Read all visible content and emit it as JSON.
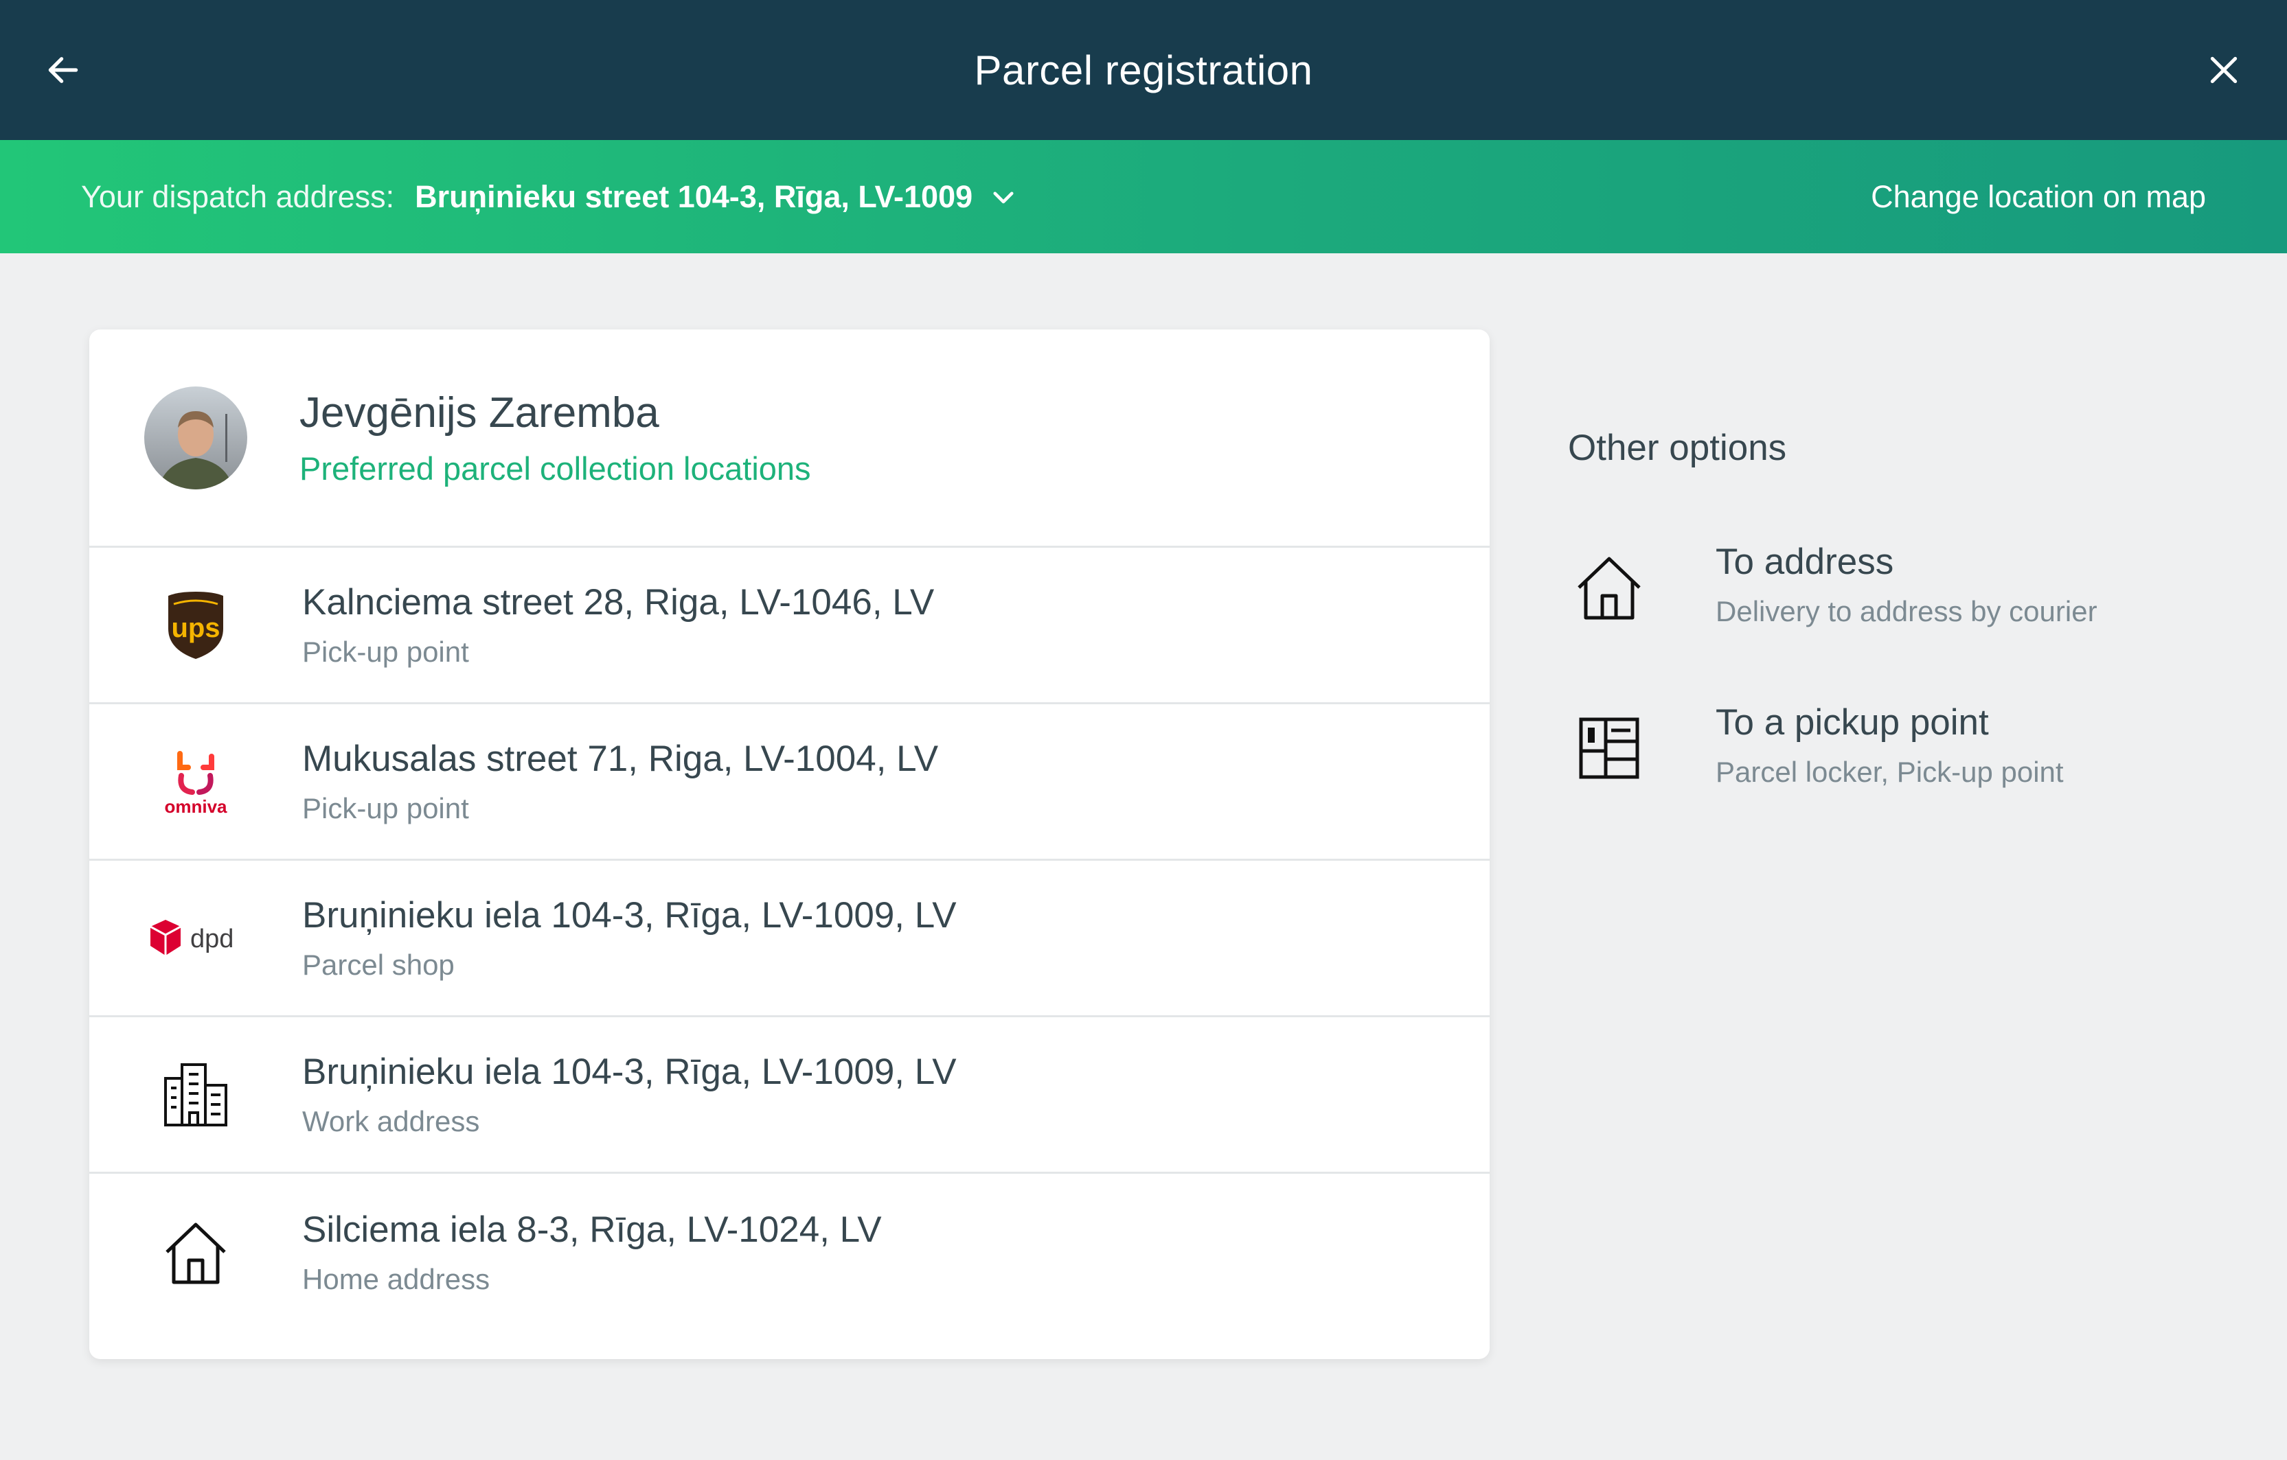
{
  "header": {
    "title": "Parcel registration",
    "back_icon": "arrow-left-icon",
    "close_icon": "close-icon",
    "bg_color": "#183c4d"
  },
  "dispatch": {
    "label": "Your dispatch address:",
    "address": "Bruņinieku street 104-3, Rīga, LV-1009",
    "change_location": "Change location on map",
    "accent_color": "#22c678"
  },
  "profile": {
    "name": "Jevgēnijs Zaremba",
    "subtitle": "Preferred parcel collection locations"
  },
  "locations": [
    {
      "icon": "ups-logo",
      "title": "Kalnciema street 28, Riga, LV-1046, LV",
      "subtitle": "Pick-up point"
    },
    {
      "icon": "omniva-logo",
      "logo_text": "omniva",
      "title": "Mukusalas street 71, Riga, LV-1004, LV",
      "subtitle": "Pick-up point"
    },
    {
      "icon": "dpd-logo",
      "logo_text": "dpd",
      "title": "Bruņinieku iela 104-3, Rīga, LV-1009, LV",
      "subtitle": "Parcel shop"
    },
    {
      "icon": "building-icon",
      "title": "Bruņinieku iela 104-3, Rīga, LV-1009, LV",
      "subtitle": "Work address"
    },
    {
      "icon": "home-icon",
      "title": "Silciema iela 8-3, Rīga, LV-1024, LV",
      "subtitle": "Home address"
    }
  ],
  "other_options": {
    "title": "Other options",
    "items": [
      {
        "icon": "home-icon",
        "title": "To address",
        "subtitle": "Delivery to address by courier"
      },
      {
        "icon": "parcel-locker-icon",
        "title": "To a pickup point",
        "subtitle": "Parcel locker, Pick-up point"
      }
    ]
  }
}
